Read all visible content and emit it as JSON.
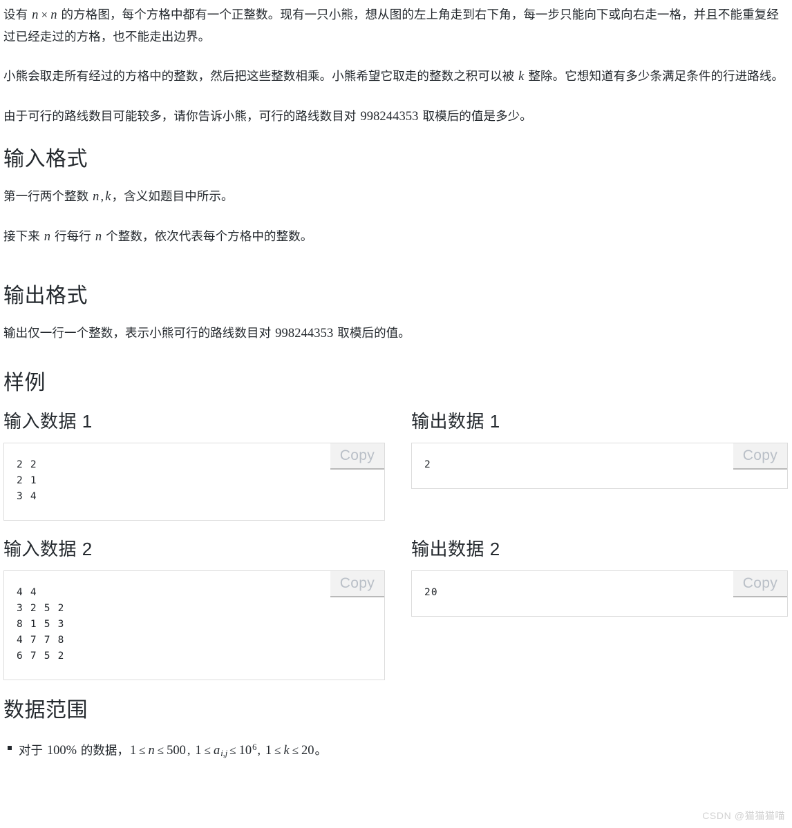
{
  "problem": {
    "statement_paragraphs": [
      {
        "id": "p1",
        "parts": [
          {
            "t": "text",
            "v": "设有 "
          },
          {
            "t": "mi",
            "v": "n"
          },
          {
            "t": "mop",
            "v": "×"
          },
          {
            "t": "mi",
            "v": "n"
          },
          {
            "t": "text",
            "v": " 的方格图，每个方格中都有一个正整数。现有一只小熊，想从图的左上角走到右下角，每一步只能向下或向右走一格，并且不能重复经过已经走过的方格，也不能走出边界。"
          }
        ]
      },
      {
        "id": "p2",
        "parts": [
          {
            "t": "text",
            "v": "小熊会取走所有经过的方格中的整数，然后把这些整数相乘。小熊希望它取走的整数之积可以被 "
          },
          {
            "t": "mi",
            "v": "k"
          },
          {
            "t": "text",
            "v": " 整除。它想知道有多少条满足条件的行进路线。"
          }
        ]
      },
      {
        "id": "p3",
        "parts": [
          {
            "t": "text",
            "v": "由于可行的路线数目可能较多，请你告诉小熊，可行的路线数目对 "
          },
          {
            "t": "mn",
            "v": "998244353"
          },
          {
            "t": "text",
            "v": " 取模后的值是多少。"
          }
        ]
      }
    ],
    "input_format": {
      "heading": "输入格式",
      "paragraphs": [
        {
          "id": "if1",
          "parts": [
            {
              "t": "text",
              "v": "第一行两个整数 "
            },
            {
              "t": "mi",
              "v": "n"
            },
            {
              "t": "mn",
              "v": ","
            },
            {
              "t": "mi",
              "v": "k"
            },
            {
              "t": "text",
              "v": "，含义如题目中所示。"
            }
          ]
        },
        {
          "id": "if2",
          "parts": [
            {
              "t": "text",
              "v": "接下来 "
            },
            {
              "t": "mi",
              "v": "n"
            },
            {
              "t": "text",
              "v": " 行每行 "
            },
            {
              "t": "mi",
              "v": "n"
            },
            {
              "t": "text",
              "v": " 个整数，依次代表每个方格中的整数。"
            }
          ]
        }
      ]
    },
    "output_format": {
      "heading": "输出格式",
      "paragraphs": [
        {
          "id": "of1",
          "parts": [
            {
              "t": "text",
              "v": "输出仅一行一个整数，表示小熊可行的路线数目对 "
            },
            {
              "t": "mn",
              "v": "998244353"
            },
            {
              "t": "text",
              "v": " 取模后的值。"
            }
          ]
        }
      ]
    },
    "samples": {
      "heading": "样例",
      "copy_label": "Copy",
      "pairs": [
        {
          "input_heading": "输入数据 1",
          "input_code": "2 2\n2 1\n3 4",
          "output_heading": "输出数据 1",
          "output_code": "2"
        },
        {
          "input_heading": "输入数据 2",
          "input_code": "4 4\n3 2 5 2\n8 1 5 3\n4 7 7 8\n6 7 5 2",
          "output_heading": "输出数据 2",
          "output_code": "20"
        }
      ]
    },
    "data_range": {
      "heading": "数据范围",
      "items": [
        {
          "id": "dr1",
          "parts": [
            {
              "t": "text",
              "v": "对于 "
            },
            {
              "t": "mn",
              "v": "100%"
            },
            {
              "t": "text",
              "v": " 的数据，"
            },
            {
              "t": "mn",
              "v": "1"
            },
            {
              "t": "mop",
              "v": "≤"
            },
            {
              "t": "mi",
              "v": "n"
            },
            {
              "t": "mop",
              "v": "≤"
            },
            {
              "t": "mn",
              "v": "500"
            },
            {
              "t": "mn",
              "v": ","
            },
            {
              "t": "text",
              "v": " "
            },
            {
              "t": "mn",
              "v": "1"
            },
            {
              "t": "mop",
              "v": "≤"
            },
            {
              "t": "mi",
              "v": "a"
            },
            {
              "t": "msub",
              "v": "i,j"
            },
            {
              "t": "mop",
              "v": "≤"
            },
            {
              "t": "mn",
              "v": "10"
            },
            {
              "t": "msup",
              "v": "6"
            },
            {
              "t": "mn",
              "v": ","
            },
            {
              "t": "text",
              "v": "  "
            },
            {
              "t": "mn",
              "v": "1"
            },
            {
              "t": "mop",
              "v": "≤"
            },
            {
              "t": "mi",
              "v": "k"
            },
            {
              "t": "mop",
              "v": "≤"
            },
            {
              "t": "mn",
              "v": "20"
            },
            {
              "t": "text",
              "v": "。"
            }
          ]
        }
      ]
    }
  },
  "watermark": "CSDN @猫猫猫喵",
  "colors": {
    "text": "#24292e",
    "code_border": "#dcdcdc",
    "copy_bg": "#f2f2f2",
    "copy_text": "#b9bfc7",
    "copy_underline": "#b9b9b9",
    "watermark": "#d2d2d2"
  }
}
